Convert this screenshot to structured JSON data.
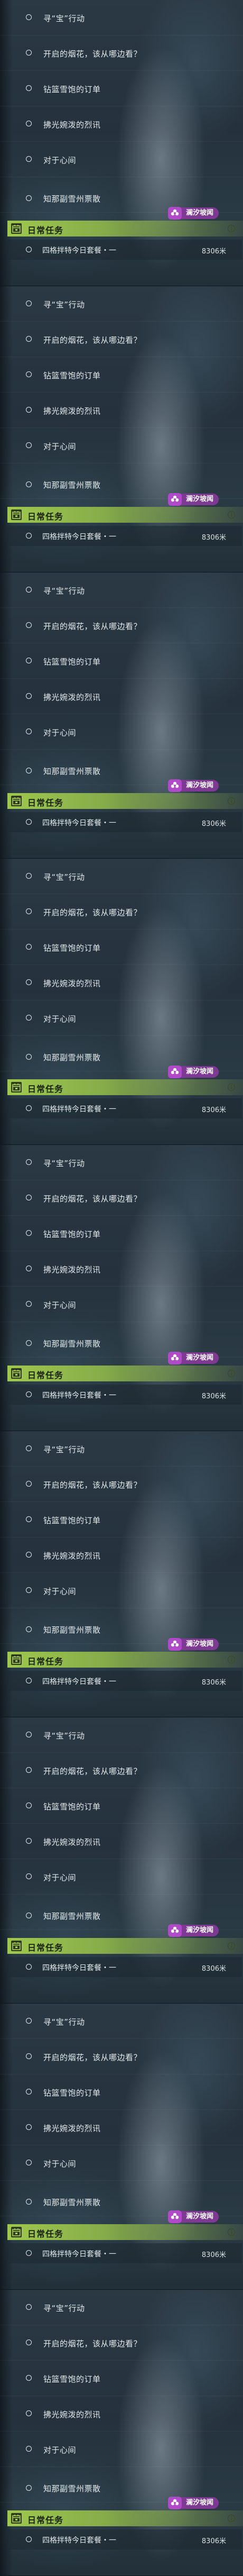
{
  "panels": [
    {
      "quests": [
        "寻“宝”行动",
        "开启的烟花，该从哪边看？",
        "钻篮雪饱的订单",
        "拂光婉泼的烈讯",
        "对于心间",
        "知那副雪州票散"
      ],
      "region_tag": "澜汐坡闻",
      "daily": {
        "title": "日常任务",
        "task": "四格拌特今日套餐・一",
        "distance": "8306米"
      }
    },
    {
      "quests": [
        "寻“宝”行动",
        "开启的烟花，该从哪边看？",
        "钻篮雪饱的订单",
        "拂光婉泼的烈讯",
        "对于心间",
        "知那副雪州票散"
      ],
      "region_tag": "澜汐坡闻",
      "daily": {
        "title": "日常任务",
        "task": "四格拌特今日套餐・一",
        "distance": "8306米"
      }
    },
    {
      "quests": [
        "寻“宝”行动",
        "开启的烟花，该从哪边看？",
        "钻篮雪饱的订单",
        "拂光婉泼的烈讯",
        "对于心间",
        "知那副雪州票散"
      ],
      "region_tag": "澜汐坡闻",
      "daily": {
        "title": "日常任务",
        "task": "四格拌特今日套餐・一",
        "distance": "8306米"
      }
    },
    {
      "quests": [
        "寻“宝”行动",
        "开启的烟花，该从哪边看？",
        "钻篮雪饱的订单",
        "拂光婉泼的烈讯",
        "对于心间",
        "知那副雪州票散"
      ],
      "region_tag": "澜汐坡闻",
      "daily": {
        "title": "日常任务",
        "task": "四格拌特今日套餐・一",
        "distance": "8306米"
      }
    },
    {
      "quests": [
        "寻“宝”行动",
        "开启的烟花，该从哪边看？",
        "钻篮雪饱的订单",
        "拂光婉泼的烈讯",
        "对于心间",
        "知那副雪州票散"
      ],
      "region_tag": "澜汐坡闻",
      "daily": {
        "title": "日常任务",
        "task": "四格拌特今日套餐・一",
        "distance": "8306米"
      }
    },
    {
      "quests": [
        "寻“宝”行动",
        "开启的烟花，该从哪边看？",
        "钻篮雪饱的订单",
        "拂光婉泼的烈讯",
        "对于心间",
        "知那副雪州票散"
      ],
      "region_tag": "澜汐坡闻",
      "daily": {
        "title": "日常任务",
        "task": "四格拌特今日套餐・一",
        "distance": "8306米"
      }
    },
    {
      "quests": [
        "寻“宝”行动",
        "开启的烟花，该从哪边看？",
        "钻篮雪饱的订单",
        "拂光婉泼的烈讯",
        "对于心间",
        "知那副雪州票散"
      ],
      "region_tag": "澜汐坡闻",
      "daily": {
        "title": "日常任务",
        "task": "四格拌特今日套餐・一",
        "distance": "8306米"
      }
    },
    {
      "quests": [
        "寻“宝”行动",
        "开启的烟花，该从哪边看？",
        "钻篮雪饱的订单",
        "拂光婉泼的烈讯",
        "对于心间",
        "知那副雪州票散"
      ],
      "region_tag": "澜汐坡闻",
      "daily": {
        "title": "日常任务",
        "task": "四格拌特今日套餐・一",
        "distance": "8306米"
      }
    },
    {
      "quests": [
        "寻“宝”行动",
        "开启的烟花，该从哪边看？",
        "钻篮雪饱的订单",
        "拂光婉泼的烈讯",
        "对于心间",
        "知那副雪州票散"
      ],
      "region_tag": "澜汐坡闻",
      "daily": {
        "title": "日常任务",
        "task": "四格拌特今日套餐・一",
        "distance": "8306米"
      }
    }
  ],
  "icons": {
    "quest_marker": "circle-icon",
    "region_tag": "flower-icon",
    "daily_header": "calendar-icon",
    "daily_info": "info-icon"
  },
  "colors": {
    "daily_header": "#9fc84c",
    "region_tag": "#7e3a93",
    "region_icon": "#b04ac8",
    "text": "#e3eaed"
  }
}
